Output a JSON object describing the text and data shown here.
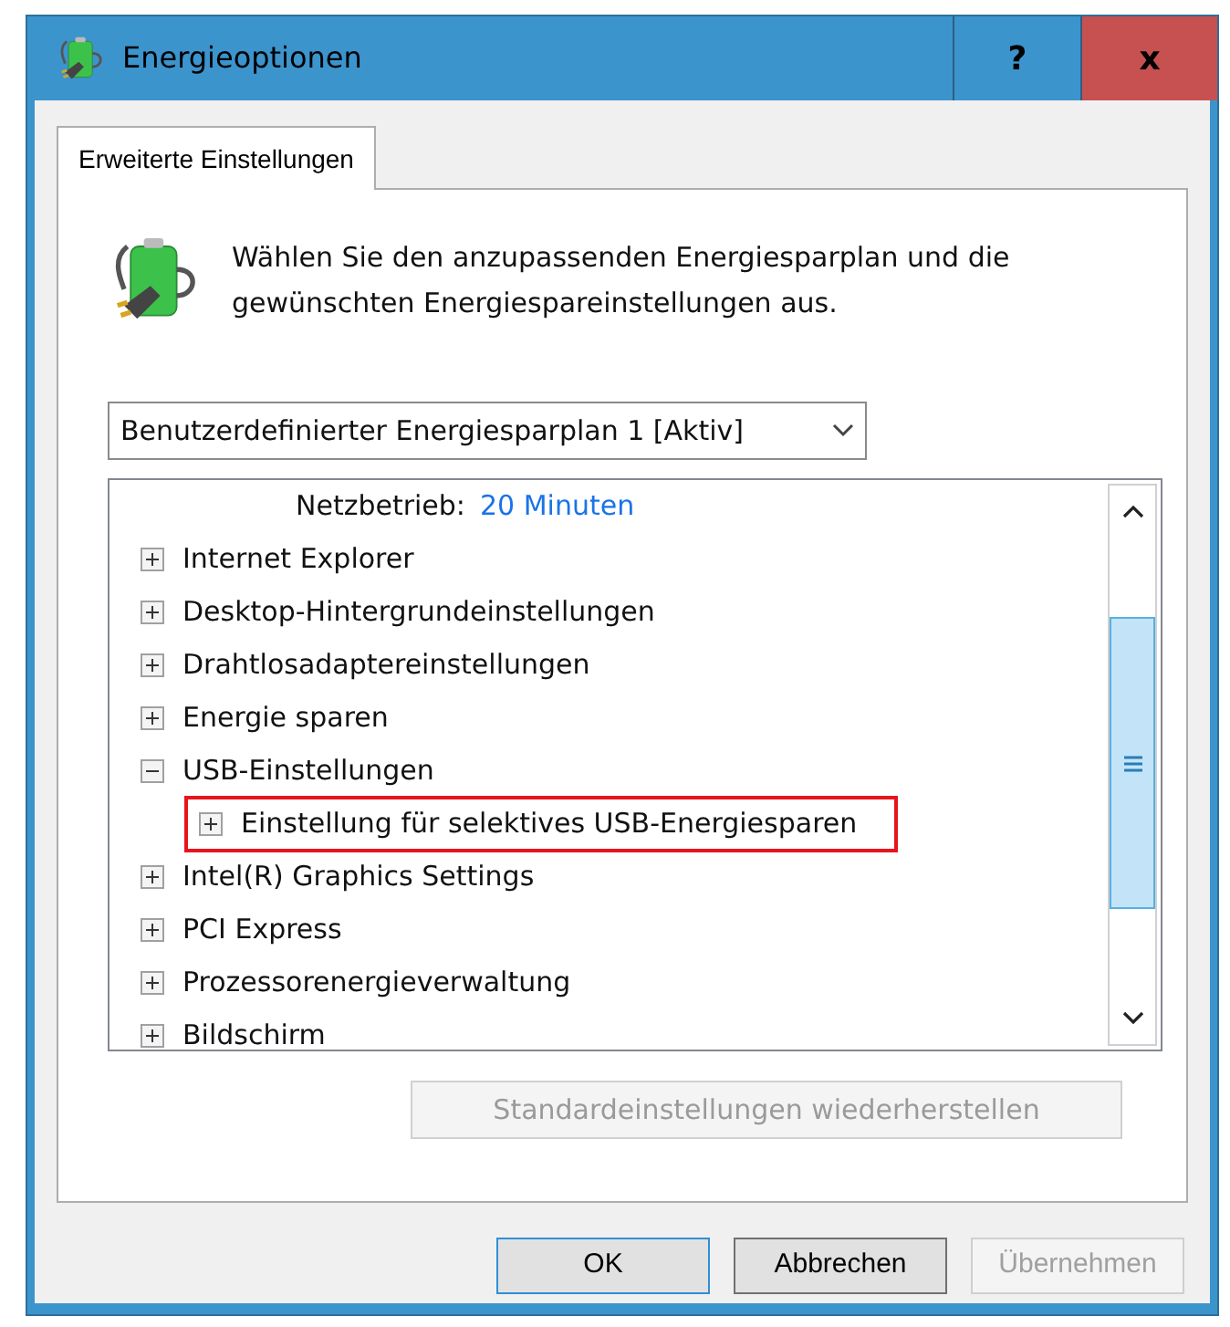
{
  "window": {
    "title": "Energieoptionen",
    "buttons": [
      {
        "kind": "help",
        "label": "?"
      },
      {
        "kind": "close",
        "label": "x"
      }
    ]
  },
  "tabs": [
    {
      "label": "Erweiterte Einstellungen",
      "selected": true
    }
  ],
  "description": "Wählen Sie den anzupassenden Energiesparplan und die gewünschten Energiespareinstellungen aus.",
  "plan_dropdown": {
    "value": "Benutzerdefinierter Energiesparplan 1 [Aktiv]"
  },
  "settings_tree": [
    {
      "kind": "value",
      "label": "Netzbetrieb:",
      "value": "20 Minuten"
    },
    {
      "kind": "node",
      "label": "Internet Explorer",
      "expanded": false,
      "highlighted": false
    },
    {
      "kind": "node",
      "label": "Desktop-Hintergrundeinstellungen",
      "expanded": false,
      "highlighted": false
    },
    {
      "kind": "node",
      "label": "Drahtlosadaptereinstellungen",
      "expanded": false,
      "highlighted": false
    },
    {
      "kind": "node",
      "label": "Energie sparen",
      "expanded": false,
      "highlighted": false
    },
    {
      "kind": "node",
      "label": "USB-Einstellungen",
      "expanded": true,
      "highlighted": false,
      "children": [
        {
          "kind": "node",
          "label": "Einstellung für selektives USB-Energiesparen",
          "expanded": false,
          "highlighted": true
        }
      ]
    },
    {
      "kind": "node",
      "label": "Intel(R) Graphics Settings",
      "expanded": false,
      "highlighted": false
    },
    {
      "kind": "node",
      "label": "PCI Express",
      "expanded": false,
      "highlighted": false
    },
    {
      "kind": "node",
      "label": "Prozessorenergieverwaltung",
      "expanded": false,
      "highlighted": false
    },
    {
      "kind": "node",
      "label": "Bildschirm",
      "expanded": false,
      "highlighted": false
    }
  ],
  "restore_button": {
    "label": "Standardeinstellungen wiederherstellen",
    "disabled": true
  },
  "buttons": [
    {
      "label": "OK",
      "disabled": false,
      "default": true
    },
    {
      "label": "Abbrechen",
      "disabled": false,
      "default": false
    },
    {
      "label": "Übernehmen",
      "disabled": true,
      "default": false
    }
  ]
}
